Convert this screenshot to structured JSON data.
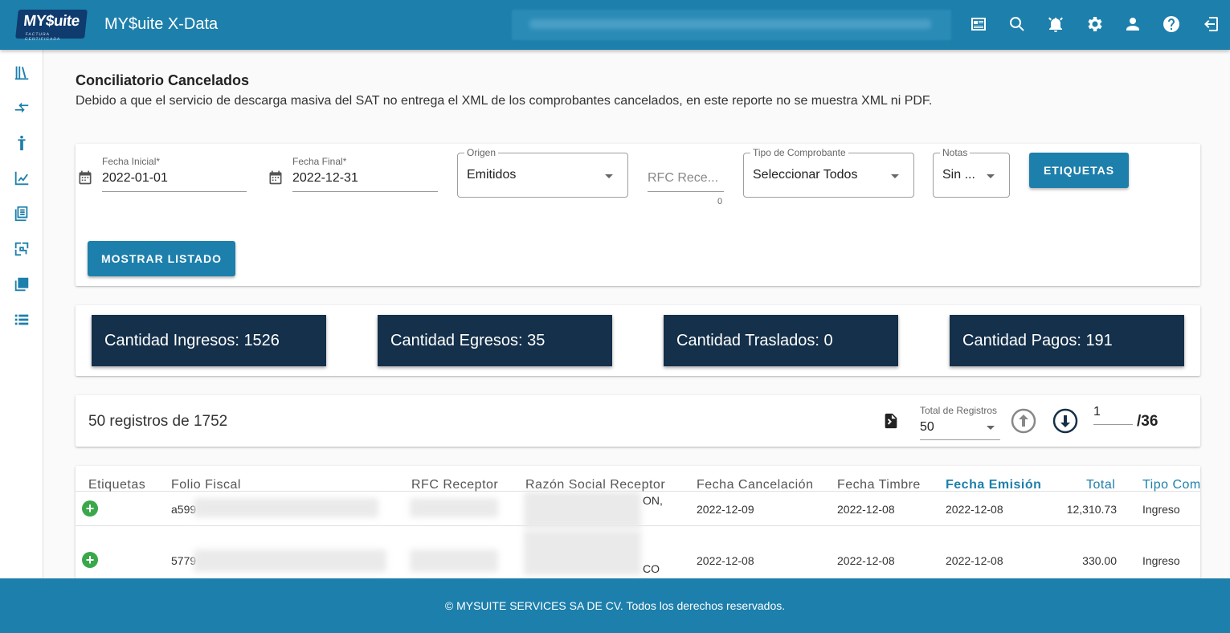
{
  "app": {
    "logo_text": "MY$uite",
    "logo_sub": "FACTURA CERTIFICADA",
    "title": "MY$uite X-Data"
  },
  "page": {
    "title": "Conciliatorio Cancelados",
    "description": "Debido a que el servicio de descarga masiva del SAT no entrega el XML de los comprobantes cancelados, en este reporte no se muestra XML ni PDF."
  },
  "filters": {
    "fecha_inicial_label": "Fecha Inicial*",
    "fecha_inicial_value": "2022-01-01",
    "fecha_final_label": "Fecha Final*",
    "fecha_final_value": "2022-12-31",
    "origen_label": "Origen",
    "origen_value": "Emitidos",
    "rfc_placeholder": "RFC Rece...",
    "rfc_counter": "0",
    "tipo_label": "Tipo de Comprobante",
    "tipo_value": "Seleccionar Todos",
    "notas_label": "Notas",
    "notas_value": "Sin ...",
    "etiquetas_button": "ETIQUETAS",
    "mostrar_button": "MOSTRAR LISTADO"
  },
  "stats": [
    {
      "label": "Cantidad Ingresos: 1526"
    },
    {
      "label": "Cantidad Egresos: 35"
    },
    {
      "label": "Cantidad Traslados: 0"
    },
    {
      "label": "Cantidad Pagos: 191"
    }
  ],
  "pagination": {
    "records_text": "50 registros de 1752",
    "total_label": "Total de Registros",
    "total_value": "50",
    "page_value": "1",
    "page_total": "/36"
  },
  "table": {
    "headers": [
      "Etiquetas",
      "Folio Fiscal",
      "RFC Receptor",
      "Razón Social Receptor",
      "Fecha Cancelación",
      "Fecha Timbre",
      "Fecha Emisión",
      "Total",
      "Tipo Com"
    ],
    "rows": [
      {
        "folio": "a599",
        "razon_tail": "ON,",
        "fecha_cancelacion": "2022-12-09",
        "fecha_timbre": "2022-12-08",
        "fecha_emision": "2022-12-08",
        "total": "12,310.73",
        "tipo": "Ingreso"
      },
      {
        "folio": "5779",
        "razon_tail": "CO",
        "fecha_cancelacion": "2022-12-08",
        "fecha_timbre": "2022-12-08",
        "fecha_emision": "2022-12-08",
        "total": "330.00",
        "tipo": "Ingreso"
      }
    ]
  },
  "footer": {
    "text": "© MYSUITE SERVICES SA DE CV. Todos los derechos reservados."
  },
  "colors": {
    "primary": "#1d7fab",
    "stat_bg": "#14304a",
    "add_green": "#3aa84a"
  }
}
